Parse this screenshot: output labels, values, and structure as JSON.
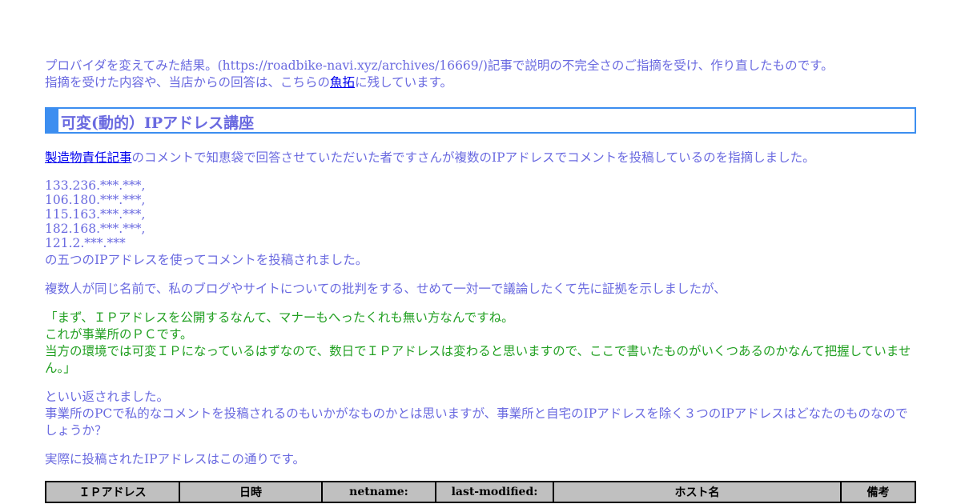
{
  "intro": {
    "line1": "プロバイダを変えてみた結果。(https://roadbike-navi.xyz/archives/16669/)記事で説明の不完全さのご指摘を受け、作り直したものです。",
    "line2_before": "指摘を受けた内容や、当店からの回答は、こちらの",
    "line2_link": "魚拓",
    "line2_after": "に残しています。"
  },
  "heading": "可変(動的）IPアドレス講座",
  "para1": {
    "link": "製造物責任記事",
    "text": "のコメントで知恵袋で回答させていただいた者ですさんが複数のIPアドレスでコメントを投稿しているのを指摘しました。"
  },
  "ips": [
    "133.236.***.***,",
    "106.180.***.***,",
    "115.163.***.***,",
    "182.168.***.***,",
    "121.2.***.***"
  ],
  "ips_after": "の五つのIPアドレスを使ってコメントを投稿されました。",
  "para2": "複数人が同じ名前で、私のブログやサイトについての批判をする、せめて一対一で議論したくて先に証拠を示しましたが、",
  "quote": [
    "「まず、ＩＰアドレスを公開するなんて、マナーもへったくれも無い方なんですね。",
    "これが事業所のＰＣです。",
    "当方の環境では可変ＩＰになっているはずなので、数日でＩＰアドレスは変わると思いますので、ここで書いたものがいくつあるのかなんて把握していません。」"
  ],
  "para3": {
    "line1": "といい返されました。",
    "line2": "事業所のPCで私的なコメントを投稿されるのもいかがなものかとは思いますが、事業所と自宅のIPアドレスを除く３つのIPアドレスはどなたのものなのでしょうか？"
  },
  "para4": "実際に投稿されたIPアドレスはこの通りです。",
  "table": {
    "headers": [
      "ＩＰアドレス",
      "日時",
      "netname:",
      "last-modified:",
      "ホスト名",
      "備考"
    ]
  },
  "colors": {
    "body_text": "#6a6ae0",
    "link": "#0000ee",
    "heading_border": "#3c8ef0",
    "quote_text": "#22a022",
    "table_header_bg": "#c0c0c0"
  }
}
